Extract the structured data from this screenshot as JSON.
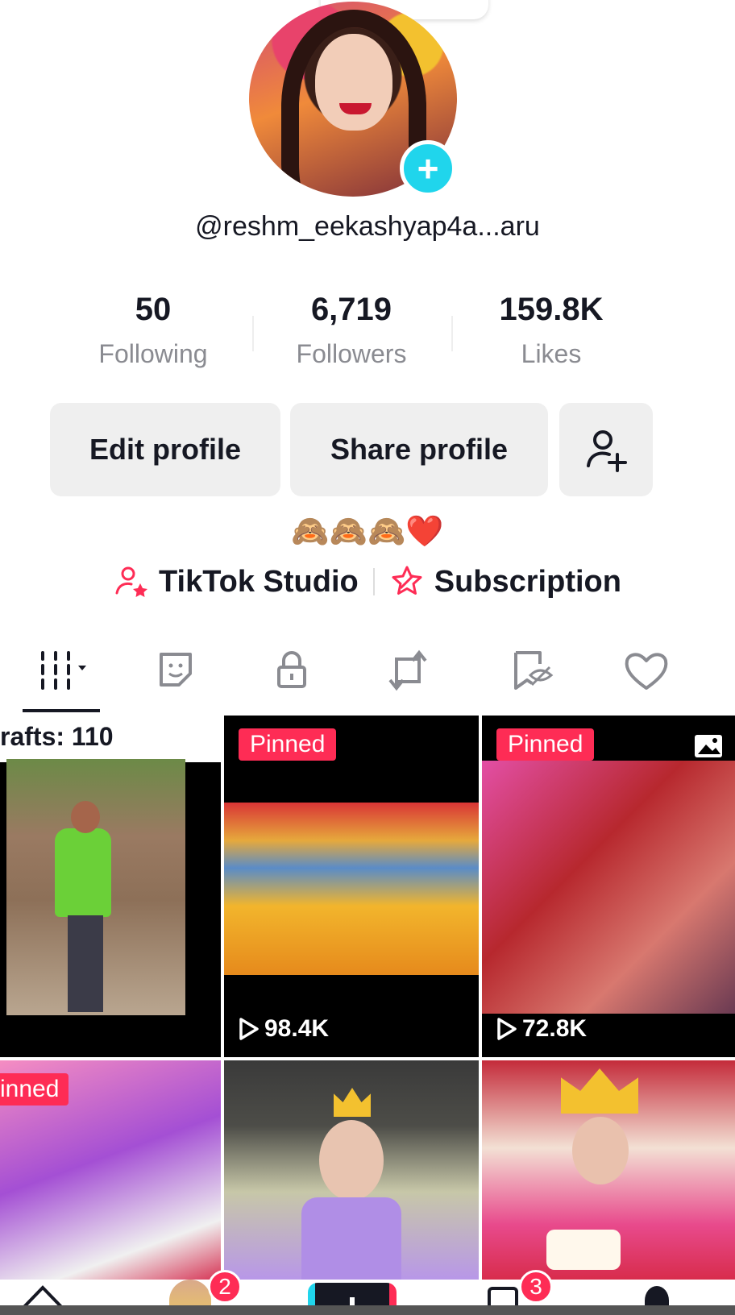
{
  "profile": {
    "username": "@reshm_eekashyap4a...aru",
    "bio": "🙈🙈🙈❤️"
  },
  "stats": [
    {
      "value": "50",
      "label": "Following"
    },
    {
      "value": "6,719",
      "label": "Followers"
    },
    {
      "value": "159.8K",
      "label": "Likes"
    }
  ],
  "actions": {
    "edit_profile": "Edit profile",
    "share_profile": "Share profile"
  },
  "links": {
    "studio": "TikTok Studio",
    "subscription": "Subscription"
  },
  "tabs": [
    "videos-grid-icon",
    "stickers-icon",
    "lock-icon",
    "repost-icon",
    "saved-icon",
    "liked-heart-icon"
  ],
  "grid": {
    "drafts_label": "rafts: 110",
    "pinned_label": "Pinned",
    "pinned_label_cut": "inned",
    "videos": [
      {
        "views": "98.4K"
      },
      {
        "views": "72.8K"
      }
    ]
  },
  "nav": {
    "inbox_badge": "2",
    "messages_badge": "3"
  },
  "colors": {
    "accent": "#fe2c55",
    "cyan": "#20d5ec",
    "text": "#161823",
    "muted": "#8a8b91"
  }
}
